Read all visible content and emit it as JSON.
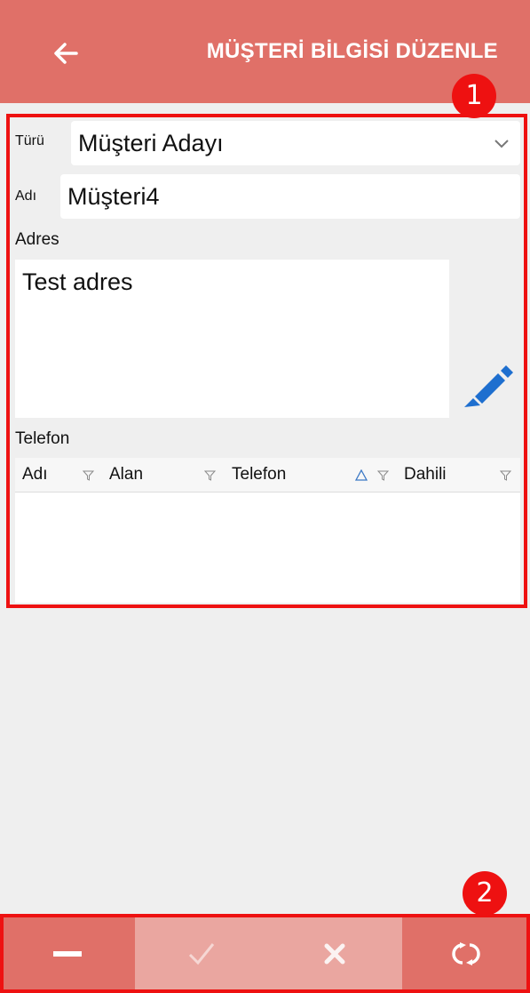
{
  "header": {
    "title": "MÜŞTERİ BİLGİSİ DÜZENLE",
    "back_icon": "arrow-left-icon"
  },
  "form": {
    "type_label": "Türü",
    "type_value": "Müşteri Adayı",
    "name_label": "Adı",
    "name_value": "Müşteri4",
    "address_label": "Adres",
    "address_value": "Test adres",
    "phone_label": "Telefon"
  },
  "phone_grid": {
    "columns": [
      "Adı",
      "Alan",
      "Telefon",
      "Dahili"
    ],
    "sorted_column": "Telefon",
    "rows": []
  },
  "toolbar": {
    "buttons": [
      {
        "icon": "minus-icon",
        "enabled": true
      },
      {
        "icon": "check-icon",
        "enabled": false
      },
      {
        "icon": "cancel-icon",
        "enabled": false
      },
      {
        "icon": "refresh-icon",
        "enabled": true
      }
    ]
  },
  "annotations": [
    "1",
    "2"
  ],
  "colors": {
    "header": "#e07068",
    "highlight": "#ee1111",
    "edit_icon": "#1e6fcf",
    "toolbar_active": "#e07068",
    "toolbar_disabled": "#eaa6a0"
  }
}
